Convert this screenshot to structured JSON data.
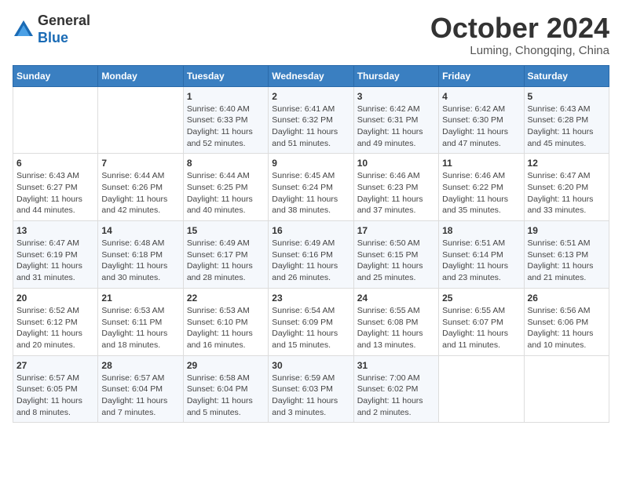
{
  "header": {
    "logo_general": "General",
    "logo_blue": "Blue",
    "month_title": "October 2024",
    "location": "Luming, Chongqing, China"
  },
  "weekdays": [
    "Sunday",
    "Monday",
    "Tuesday",
    "Wednesday",
    "Thursday",
    "Friday",
    "Saturday"
  ],
  "weeks": [
    [
      {
        "day": "",
        "info": ""
      },
      {
        "day": "",
        "info": ""
      },
      {
        "day": "1",
        "info": "Sunrise: 6:40 AM\nSunset: 6:33 PM\nDaylight: 11 hours and 52 minutes."
      },
      {
        "day": "2",
        "info": "Sunrise: 6:41 AM\nSunset: 6:32 PM\nDaylight: 11 hours and 51 minutes."
      },
      {
        "day": "3",
        "info": "Sunrise: 6:42 AM\nSunset: 6:31 PM\nDaylight: 11 hours and 49 minutes."
      },
      {
        "day": "4",
        "info": "Sunrise: 6:42 AM\nSunset: 6:30 PM\nDaylight: 11 hours and 47 minutes."
      },
      {
        "day": "5",
        "info": "Sunrise: 6:43 AM\nSunset: 6:28 PM\nDaylight: 11 hours and 45 minutes."
      }
    ],
    [
      {
        "day": "6",
        "info": "Sunrise: 6:43 AM\nSunset: 6:27 PM\nDaylight: 11 hours and 44 minutes."
      },
      {
        "day": "7",
        "info": "Sunrise: 6:44 AM\nSunset: 6:26 PM\nDaylight: 11 hours and 42 minutes."
      },
      {
        "day": "8",
        "info": "Sunrise: 6:44 AM\nSunset: 6:25 PM\nDaylight: 11 hours and 40 minutes."
      },
      {
        "day": "9",
        "info": "Sunrise: 6:45 AM\nSunset: 6:24 PM\nDaylight: 11 hours and 38 minutes."
      },
      {
        "day": "10",
        "info": "Sunrise: 6:46 AM\nSunset: 6:23 PM\nDaylight: 11 hours and 37 minutes."
      },
      {
        "day": "11",
        "info": "Sunrise: 6:46 AM\nSunset: 6:22 PM\nDaylight: 11 hours and 35 minutes."
      },
      {
        "day": "12",
        "info": "Sunrise: 6:47 AM\nSunset: 6:20 PM\nDaylight: 11 hours and 33 minutes."
      }
    ],
    [
      {
        "day": "13",
        "info": "Sunrise: 6:47 AM\nSunset: 6:19 PM\nDaylight: 11 hours and 31 minutes."
      },
      {
        "day": "14",
        "info": "Sunrise: 6:48 AM\nSunset: 6:18 PM\nDaylight: 11 hours and 30 minutes."
      },
      {
        "day": "15",
        "info": "Sunrise: 6:49 AM\nSunset: 6:17 PM\nDaylight: 11 hours and 28 minutes."
      },
      {
        "day": "16",
        "info": "Sunrise: 6:49 AM\nSunset: 6:16 PM\nDaylight: 11 hours and 26 minutes."
      },
      {
        "day": "17",
        "info": "Sunrise: 6:50 AM\nSunset: 6:15 PM\nDaylight: 11 hours and 25 minutes."
      },
      {
        "day": "18",
        "info": "Sunrise: 6:51 AM\nSunset: 6:14 PM\nDaylight: 11 hours and 23 minutes."
      },
      {
        "day": "19",
        "info": "Sunrise: 6:51 AM\nSunset: 6:13 PM\nDaylight: 11 hours and 21 minutes."
      }
    ],
    [
      {
        "day": "20",
        "info": "Sunrise: 6:52 AM\nSunset: 6:12 PM\nDaylight: 11 hours and 20 minutes."
      },
      {
        "day": "21",
        "info": "Sunrise: 6:53 AM\nSunset: 6:11 PM\nDaylight: 11 hours and 18 minutes."
      },
      {
        "day": "22",
        "info": "Sunrise: 6:53 AM\nSunset: 6:10 PM\nDaylight: 11 hours and 16 minutes."
      },
      {
        "day": "23",
        "info": "Sunrise: 6:54 AM\nSunset: 6:09 PM\nDaylight: 11 hours and 15 minutes."
      },
      {
        "day": "24",
        "info": "Sunrise: 6:55 AM\nSunset: 6:08 PM\nDaylight: 11 hours and 13 minutes."
      },
      {
        "day": "25",
        "info": "Sunrise: 6:55 AM\nSunset: 6:07 PM\nDaylight: 11 hours and 11 minutes."
      },
      {
        "day": "26",
        "info": "Sunrise: 6:56 AM\nSunset: 6:06 PM\nDaylight: 11 hours and 10 minutes."
      }
    ],
    [
      {
        "day": "27",
        "info": "Sunrise: 6:57 AM\nSunset: 6:05 PM\nDaylight: 11 hours and 8 minutes."
      },
      {
        "day": "28",
        "info": "Sunrise: 6:57 AM\nSunset: 6:04 PM\nDaylight: 11 hours and 7 minutes."
      },
      {
        "day": "29",
        "info": "Sunrise: 6:58 AM\nSunset: 6:04 PM\nDaylight: 11 hours and 5 minutes."
      },
      {
        "day": "30",
        "info": "Sunrise: 6:59 AM\nSunset: 6:03 PM\nDaylight: 11 hours and 3 minutes."
      },
      {
        "day": "31",
        "info": "Sunrise: 7:00 AM\nSunset: 6:02 PM\nDaylight: 11 hours and 2 minutes."
      },
      {
        "day": "",
        "info": ""
      },
      {
        "day": "",
        "info": ""
      }
    ]
  ]
}
